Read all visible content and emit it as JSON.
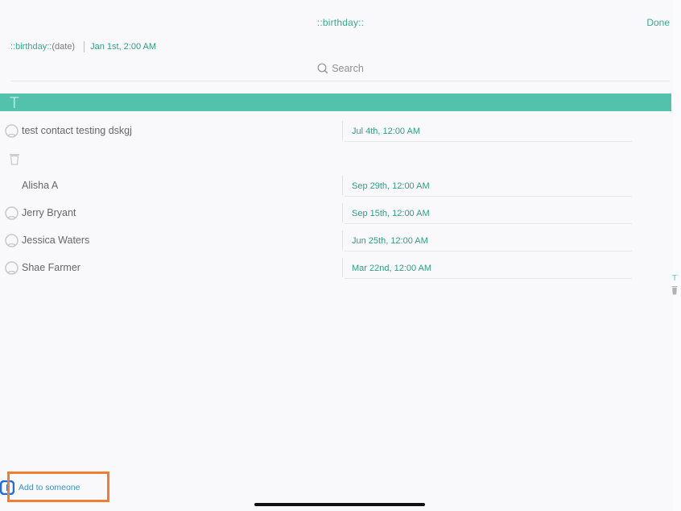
{
  "nav": {
    "title": "::birthday::",
    "done_label": "Done"
  },
  "field": {
    "token": "::birthday::",
    "type": "(date)",
    "value": "Jan 1st, 2:00 AM"
  },
  "search": {
    "placeholder": "Search"
  },
  "section": {
    "letter": "T"
  },
  "contacts": [
    {
      "name": "test contact testing dskgj",
      "date": "Jul 4th, 12:00 AM",
      "avatar": true
    },
    {
      "name": "Alisha A",
      "date": "Sep 29th, 12:00 AM",
      "avatar": false
    },
    {
      "name": "Jerry Bryant",
      "date": "Sep 15th, 12:00 AM",
      "avatar": true
    },
    {
      "name": "Jessica Waters",
      "date": "Jun 25th, 12:00 AM",
      "avatar": true
    },
    {
      "name": "Shae Farmer",
      "date": "Mar 22nd, 12:00 AM",
      "avatar": true
    }
  ],
  "index": {
    "letter": "T"
  },
  "footer": {
    "add_label": "Add to someone"
  },
  "colors": {
    "accent": "#39a98e",
    "section": "#53c2ad",
    "highlight": "#ef7f2f",
    "link": "#3a8fc9"
  }
}
